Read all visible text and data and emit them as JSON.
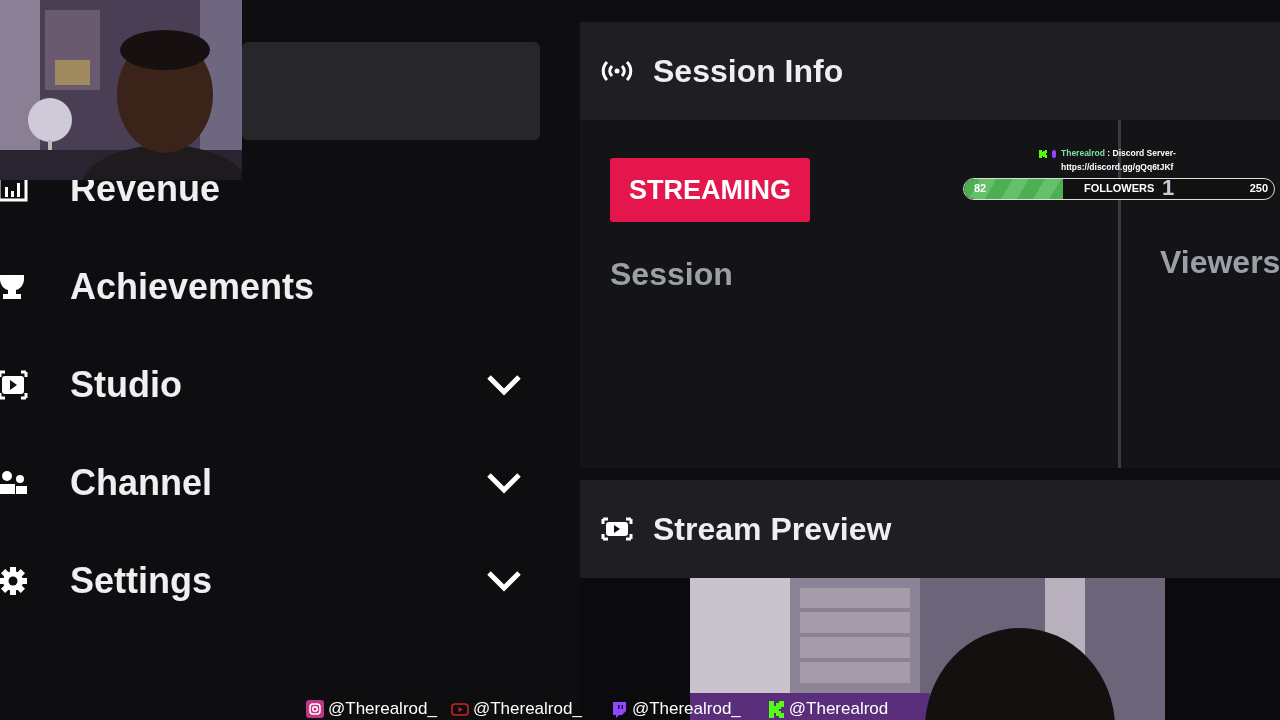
{
  "sidebar": {
    "items": [
      {
        "label": "Revenue",
        "expandable": false
      },
      {
        "label": "Achievements",
        "expandable": false
      },
      {
        "label": "Studio",
        "expandable": true
      },
      {
        "label": "Channel",
        "expandable": true
      },
      {
        "label": "Settings",
        "expandable": true
      }
    ]
  },
  "session_info": {
    "title": "Session Info",
    "status": "STREAMING",
    "session_label": "Session",
    "viewers_label": "Viewers"
  },
  "stream_preview": {
    "title": "Stream Preview"
  },
  "overlay": {
    "chat": {
      "user": "Therealrod",
      "message": ": Discord Server- https://discord.gg/gQq6tJKf"
    },
    "goal": {
      "current": "82",
      "label": "FOLLOWERS",
      "target": "250",
      "level": 0.32
    },
    "digit": "1",
    "socials": [
      {
        "kind": "instagram",
        "handle": "@Therealrod_"
      },
      {
        "kind": "youtube",
        "handle": "@Therealrod_"
      },
      {
        "kind": "twitch",
        "handle": "@Therealrod_"
      },
      {
        "kind": "kick",
        "handle": "@Therealrod"
      }
    ]
  }
}
